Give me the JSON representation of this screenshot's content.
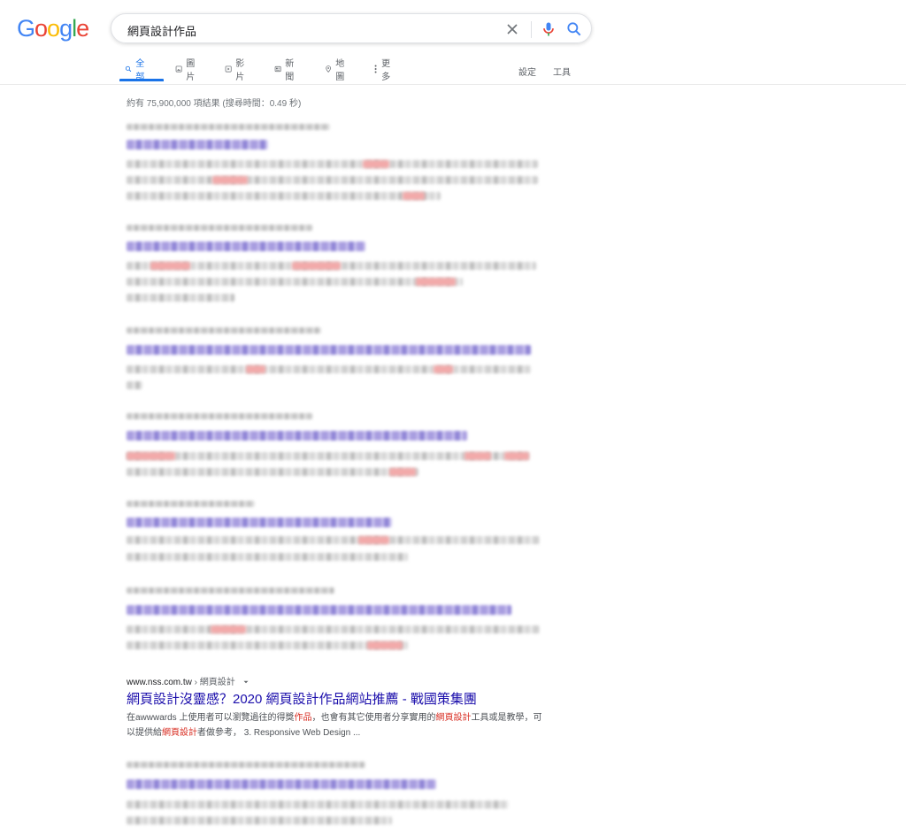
{
  "logo": {
    "letters": [
      "G",
      "o",
      "o",
      "g",
      "l",
      "e"
    ],
    "colors": [
      "#4285F4",
      "#EA4335",
      "#FBBC05",
      "#4285F4",
      "#34A853",
      "#EA4335"
    ]
  },
  "search": {
    "query": "網頁設計作品",
    "clear_icon": "close-icon",
    "mic_icon": "mic-icon",
    "search_icon": "search-icon"
  },
  "tabs": [
    {
      "label": "全部",
      "icon": "search-icon",
      "active": true
    },
    {
      "label": "圖片",
      "icon": "image-icon"
    },
    {
      "label": "影片",
      "icon": "video-icon"
    },
    {
      "label": "新聞",
      "icon": "news-icon"
    },
    {
      "label": "地圖",
      "icon": "map-pin-icon"
    },
    {
      "label": "更多",
      "icon": "more-vert-icon"
    }
  ],
  "tools": {
    "settings": "設定",
    "tools": "工具"
  },
  "stats": "約有 75,900,000 項結果 (搜尋時間：0.49 秒)",
  "result": {
    "cite_domain": "www.nss.com.tw",
    "cite_path": " › 網頁設計",
    "title": "網頁設計沒靈感？2020 網頁設計作品網站推薦 - 戰國策集團",
    "snippet": [
      {
        "t": "在awwwards 上使用者可以瀏覽過往的得獎"
      },
      {
        "t": "作品",
        "h": true
      },
      {
        "t": "，也會有其它使用者分享實用的"
      },
      {
        "t": "網頁設計",
        "h": true
      },
      {
        "t": "工具或是教學，可以提供給"
      },
      {
        "t": "網頁設計",
        "h": true
      },
      {
        "t": "者做參考， 3. Responsive Web Design ..."
      }
    ]
  },
  "colors": {
    "accent": "#1a73e8",
    "link": "#1a0dab",
    "highlight": "#d93025"
  }
}
